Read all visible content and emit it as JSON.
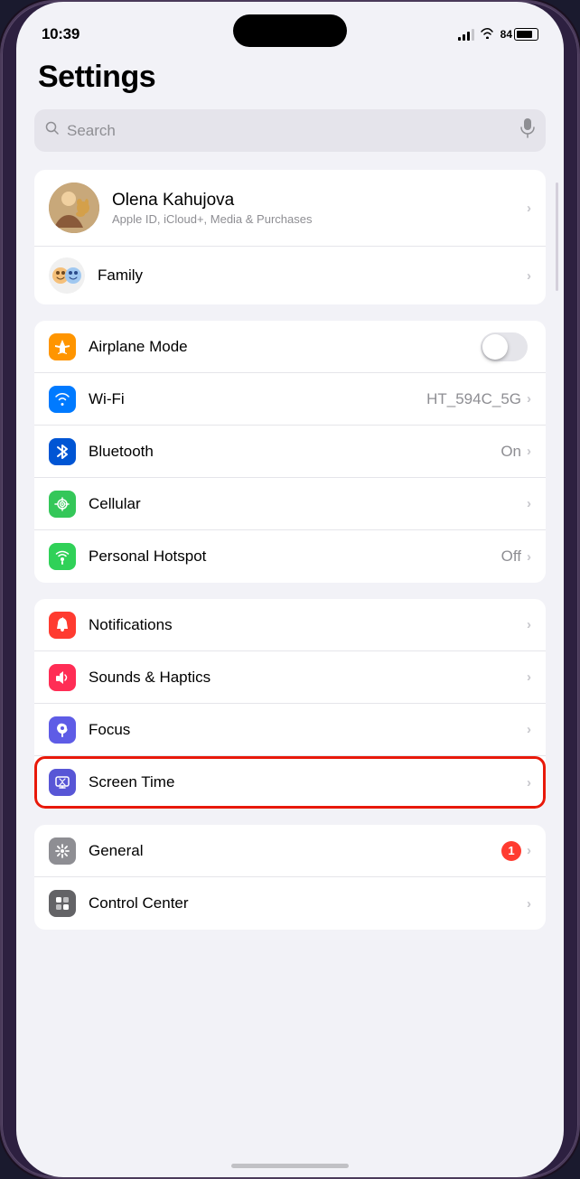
{
  "status_bar": {
    "time": "10:39",
    "battery_level": "84",
    "battery_text": "84"
  },
  "page": {
    "title": "Settings"
  },
  "search": {
    "placeholder": "Search"
  },
  "profile_section": {
    "name": "Olena Kahujova",
    "subtitle": "Apple ID, iCloud+, Media & Purchases",
    "family_label": "Family"
  },
  "network_section": [
    {
      "id": "airplane-mode",
      "label": "Airplane Mode",
      "value": "",
      "has_toggle": true,
      "toggle_on": false,
      "icon_color": "orange",
      "icon_symbol": "✈"
    },
    {
      "id": "wifi",
      "label": "Wi-Fi",
      "value": "HT_594C_5G",
      "has_toggle": false,
      "icon_color": "blue",
      "icon_symbol": "wifi"
    },
    {
      "id": "bluetooth",
      "label": "Bluetooth",
      "value": "On",
      "has_toggle": false,
      "icon_color": "blue-dark",
      "icon_symbol": "bluetooth"
    },
    {
      "id": "cellular",
      "label": "Cellular",
      "value": "",
      "has_toggle": false,
      "icon_color": "green",
      "icon_symbol": "cellular"
    },
    {
      "id": "personal-hotspot",
      "label": "Personal Hotspot",
      "value": "Off",
      "has_toggle": false,
      "icon_color": "green2",
      "icon_symbol": "hotspot"
    }
  ],
  "system_section": [
    {
      "id": "notifications",
      "label": "Notifications",
      "value": "",
      "icon_color": "red",
      "icon_symbol": "notifications"
    },
    {
      "id": "sounds-haptics",
      "label": "Sounds & Haptics",
      "value": "",
      "icon_color": "pink",
      "icon_symbol": "sounds"
    },
    {
      "id": "focus",
      "label": "Focus",
      "value": "",
      "icon_color": "indigo",
      "icon_symbol": "focus"
    },
    {
      "id": "screen-time",
      "label": "Screen Time",
      "value": "",
      "highlighted": true,
      "icon_color": "purple",
      "icon_symbol": "screentime"
    }
  ],
  "general_section": [
    {
      "id": "general",
      "label": "General",
      "value": "",
      "badge": "1",
      "icon_color": "gray",
      "icon_symbol": "general"
    },
    {
      "id": "control-center",
      "label": "Control Center",
      "value": "",
      "icon_color": "gray2",
      "icon_symbol": "control"
    }
  ]
}
